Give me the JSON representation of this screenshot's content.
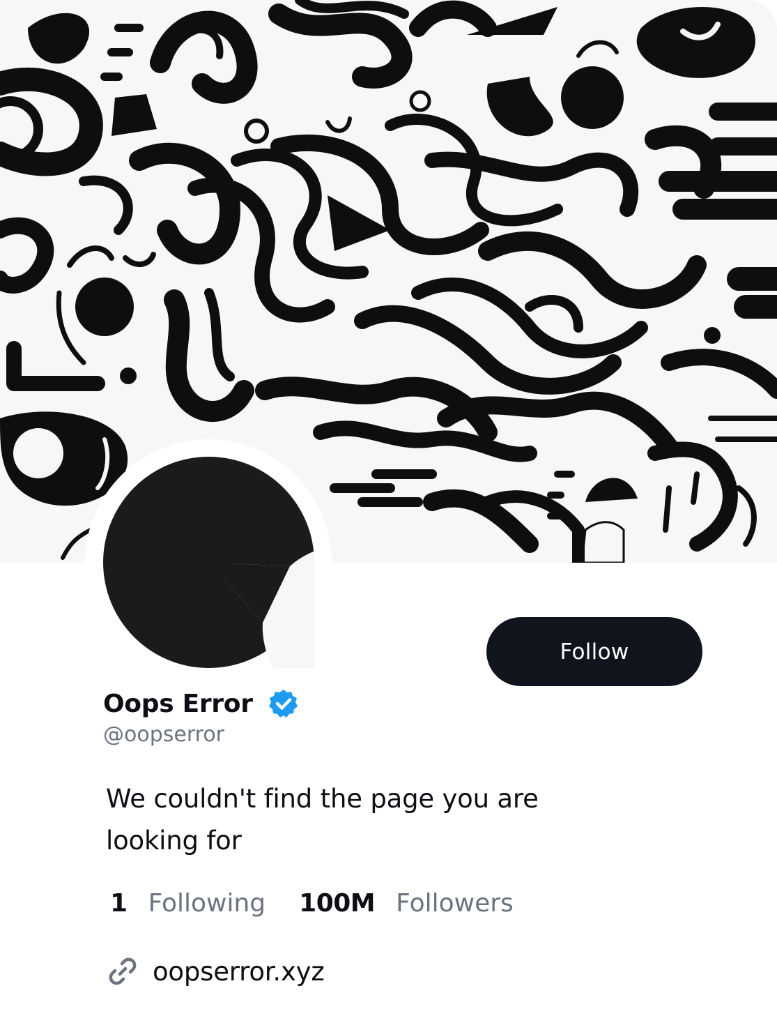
{
  "profile": {
    "display_name": "Oops Error",
    "handle": "@oopserror",
    "verified": true,
    "bio": "We couldn't find the page you are looking for",
    "follow_label": "Follow",
    "link_text": "oopserror.xyz"
  },
  "stats": {
    "following_count": "1",
    "following_label": "Following",
    "followers_count": "100M",
    "followers_label": "Followers"
  },
  "icons": {
    "verified": "verified-badge-icon",
    "link": "link-icon",
    "avatar": "logo-avatar"
  },
  "colors": {
    "button_bg": "#10141c",
    "verified_blue": "#1d9bf0",
    "muted_text": "#6b7280",
    "primary_text": "#0d0f14"
  }
}
